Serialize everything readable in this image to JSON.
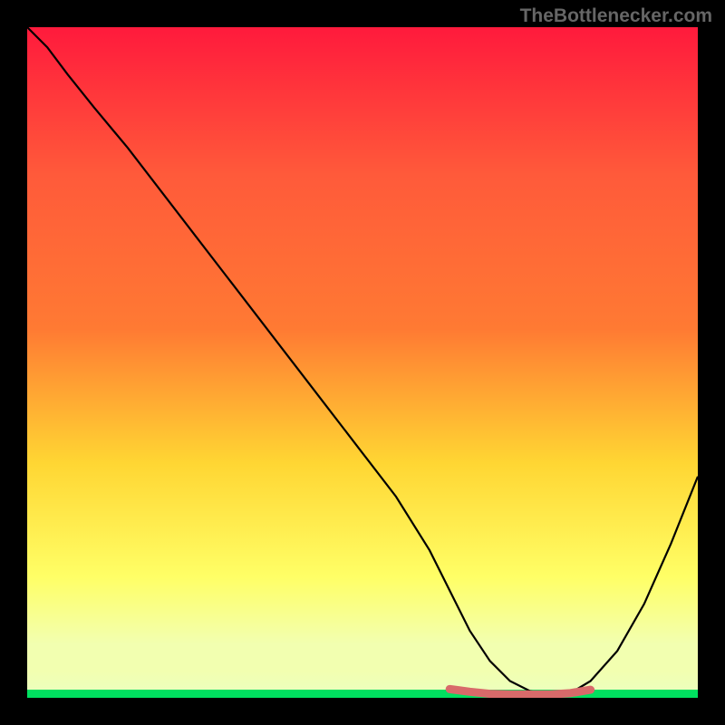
{
  "watermark": "TheBottlenecker.com",
  "chart_data": {
    "type": "line",
    "title": "",
    "xlabel": "",
    "ylabel": "",
    "xlim": [
      0,
      100
    ],
    "ylim": [
      0,
      100
    ],
    "background_gradient": {
      "top": "#ff1a3c",
      "upper_mid": "#ff7a33",
      "mid": "#ffd633",
      "lower_mid": "#ffff66",
      "bottom_band": "#f2ffb0",
      "baseline": "#00e060"
    },
    "series": [
      {
        "name": "curve",
        "color": "#000000",
        "x": [
          0,
          3,
          6,
          10,
          15,
          20,
          25,
          30,
          35,
          40,
          45,
          50,
          55,
          60,
          63,
          66,
          69,
          72,
          75,
          78,
          81,
          84,
          88,
          92,
          96,
          100
        ],
        "y": [
          100,
          97,
          93,
          88,
          82,
          75.5,
          69,
          62.5,
          56,
          49.5,
          43,
          36.5,
          30,
          22,
          16,
          10,
          5.5,
          2.5,
          1,
          0.5,
          0.7,
          2.5,
          7,
          14,
          23,
          33
        ]
      },
      {
        "name": "bottom-highlight",
        "color": "#d86a6a",
        "thick": true,
        "x": [
          63,
          66,
          69,
          72,
          75,
          78,
          81,
          84
        ],
        "y": [
          1.3,
          0.9,
          0.6,
          0.5,
          0.5,
          0.5,
          0.7,
          1.2
        ]
      }
    ]
  }
}
